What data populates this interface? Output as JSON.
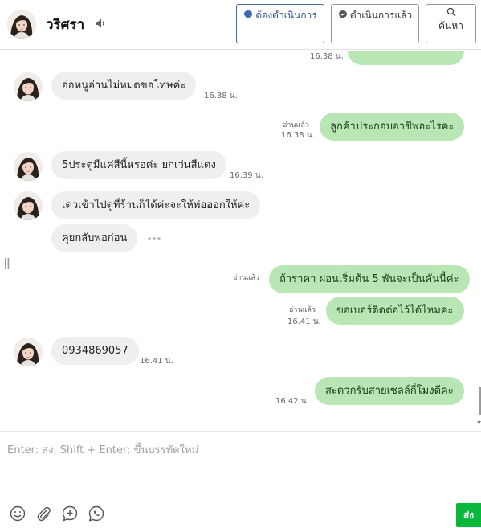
{
  "header": {
    "contact_name": "วริศรา",
    "buttons": {
      "todo": "ต้องดำเนินการ",
      "done": "ดำเนินการแล้ว",
      "search": "ค้นหา"
    }
  },
  "messages": [
    {
      "side": "out",
      "text": "",
      "time": "16.38 น."
    },
    {
      "side": "in",
      "text": "อ่อหนูอ่านไม่หมดขอโทษค่ะ",
      "time": "16.38 น."
    },
    {
      "side": "out",
      "text": "ลูกค้าประกอบอาชีพอะไรคะ",
      "read": "อ่านแล้ว",
      "time": "16.38 น."
    },
    {
      "side": "in",
      "text": "5ประตูมีแค่สีนี้หรอค่ะ ยกเว่นสีแดง",
      "time": "16.39 น."
    },
    {
      "side": "in",
      "text": "เดวเข้าไปดูที่ร้านก็ได้ค่ะจะให้พ่อออกให้ค่ะ"
    },
    {
      "side": "in",
      "text": "คุยกลับพ่อก่อน"
    },
    {
      "side": "out",
      "text": "ถ้าราคา ผ่อนเริ่มต้น 5 พันจะเป็นคันนี้ค่ะ",
      "read": "อ่านแล้ว"
    },
    {
      "side": "out",
      "text": "ขอเบอร์ติดต่อไว้ได้ไหมคะ",
      "read": "อ่านแล้ว",
      "time": "16.41 น."
    },
    {
      "side": "in",
      "text": "0934869057",
      "time": "16.41 น."
    },
    {
      "side": "out",
      "text": "สะดวกรับสายเซลล์กี่โมงดีคะ",
      "time": "16.42 น."
    }
  ],
  "composer": {
    "placeholder": "Enter: ส่ง, Shift + Enter: ขึ้นบรรทัดใหม่",
    "send_label": "ส่ง"
  },
  "icons": [
    "speaker-icon",
    "chat-bubble-icon",
    "search-icon",
    "more-icon",
    "emoji-icon",
    "attachment-icon",
    "add-icon",
    "whatsapp-icon"
  ],
  "colors": {
    "incoming_bubble": "#efeff0",
    "outgoing_bubble": "#b9e6b5",
    "send_button": "#08b83a",
    "todo_button_border": "#4a6aa8"
  }
}
